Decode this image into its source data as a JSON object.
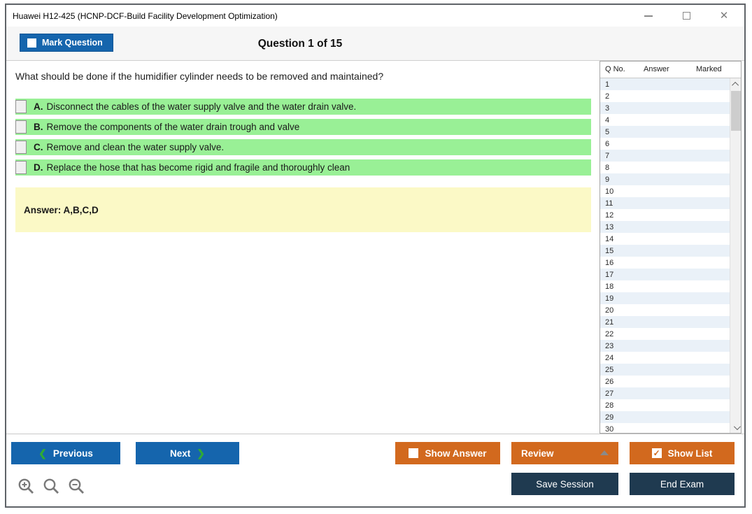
{
  "window": {
    "title": "Huawei H12-425 (HCNP-DCF-Build Facility Development Optimization)",
    "control_icons": [
      "minimize-icon",
      "maximize-icon",
      "close-icon"
    ]
  },
  "header": {
    "mark_question_label": "Mark Question",
    "question_counter": "Question 1 of 15"
  },
  "question": {
    "text": "What should be done if the humidifier cylinder needs to be removed and maintained?",
    "options": [
      {
        "letter": "A.",
        "text": "Disconnect the cables of the water supply valve and the water drain valve."
      },
      {
        "letter": "B.",
        "text": "Remove the components of the water drain trough and valve"
      },
      {
        "letter": "C.",
        "text": "Remove and clean the water supply valve."
      },
      {
        "letter": "D.",
        "text": "Replace the hose that has become rigid and fragile and thoroughly clean"
      }
    ],
    "answer_label": "Answer: A,B,C,D"
  },
  "question_list": {
    "columns": {
      "qno": "Q No.",
      "answer": "Answer",
      "marked": "Marked"
    },
    "rows": [
      "1",
      "2",
      "3",
      "4",
      "5",
      "6",
      "7",
      "8",
      "9",
      "10",
      "11",
      "12",
      "13",
      "14",
      "15",
      "16",
      "17",
      "18",
      "19",
      "20",
      "21",
      "22",
      "23",
      "24",
      "25",
      "26",
      "27",
      "28",
      "29",
      "30"
    ],
    "scroll_icons": [
      "scroll-up-icon",
      "scroll-down-icon"
    ]
  },
  "footer": {
    "previous_label": "Previous",
    "next_label": "Next",
    "show_answer_label": "Show Answer",
    "review_label": "Review",
    "show_list_label": "Show List",
    "save_session_label": "Save Session",
    "end_exam_label": "End Exam",
    "show_list_checked": "✓",
    "zoom_icons": [
      "zoom-in-icon",
      "zoom-reset-icon",
      "zoom-out-icon"
    ]
  },
  "colors": {
    "primary_blue": "#1565ad",
    "accent_orange": "#d2691e",
    "dark_navy": "#1f3a50",
    "option_green": "#99f096",
    "answer_yellow": "#fbf9c6",
    "row_alt_blue": "#eaf1f8",
    "chevron_green": "#2faa35"
  }
}
